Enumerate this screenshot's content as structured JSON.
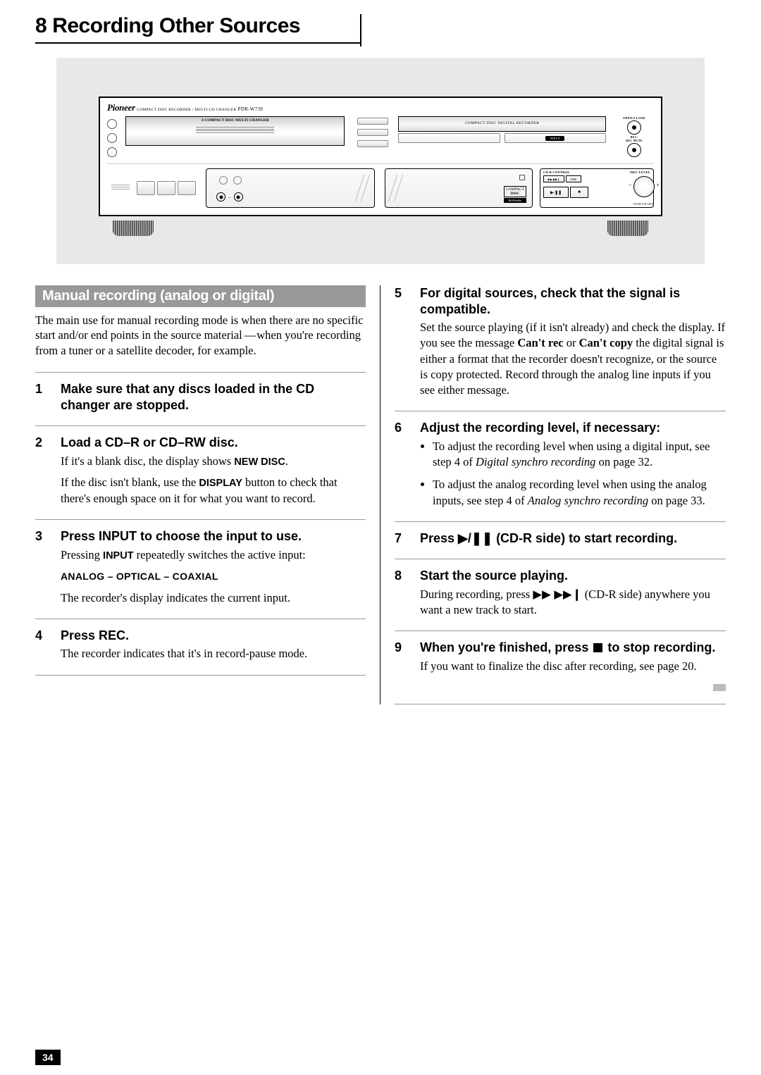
{
  "chapter": {
    "number": "8",
    "title": "Recording Other Sources"
  },
  "device": {
    "brand": "Pioneer",
    "brand_sub": "COMPACT DISC RECORDER / MULTI-CD CHANGER",
    "model": "PDR-W739",
    "changer_label": "3-COMPACT DISC MULTI CHANGER",
    "recorder_label": "COMPACT DISC DIGITAL RECORDER",
    "input_chip": "INPUT",
    "open_close": "OPEN/CLOSE",
    "rec_mute": "REC/\nREC MUTE",
    "cdr_control": "CD-R CONTROL",
    "rec_level": "○REC LEVEL",
    "disp": "DISP",
    "play_pause": "▶/❚❚",
    "stop": "■",
    "ff": "▶▶ ▶▶❙",
    "push": "PUSH ON-OFF",
    "cd_logo": "COMPACT",
    "disc_logo": "DISC",
    "rewritable": "ReWritable"
  },
  "subsection": "Manual recording (analog or digital)",
  "intro_prefix": "The main use for manual recording mode is when there are no specific start and/or end points in the source material",
  "intro_suffix": "when you're recording from a tuner or a satellite decoder, for example.",
  "steps_left": [
    {
      "n": "1",
      "title": "Make sure that any discs loaded in the CD changer are stopped."
    },
    {
      "n": "2",
      "title": "Load a CD–R or CD–RW disc.",
      "body": [
        "If it's a blank disc, the display shows <span class='scaps'>NEW DISC</span>.",
        "If the disc isn't blank, use the <span class='scaps'>DISPLAY</span> button to check that there's enough space on it for what you want to record."
      ]
    },
    {
      "n": "3",
      "title": "Press INPUT to choose the input to use.",
      "body": [
        "Pressing <span class='scaps'>INPUT</span> repeatedly switches the active input:",
        "<span class='caps'>ANALOG – OPTICAL – COAXIAL</span>",
        "The recorder's display indicates the current input."
      ]
    },
    {
      "n": "4",
      "title": "Press REC.",
      "body": [
        "The recorder indicates that it's in record-pause mode."
      ]
    }
  ],
  "steps_right": [
    {
      "n": "5",
      "title": "For digital sources, check that the signal is compatible.",
      "body": [
        "Set the source playing (if it isn't already) and check the display. If you see the message <b>Can't rec</b> or <b>Can't copy</b> the digital signal is either a format that the recorder doesn't recognize, or the source is copy protected. Record through the analog line inputs if you see either message."
      ]
    },
    {
      "n": "6",
      "title": "Adjust the recording level, if necessary:",
      "bullets": [
        "To adjust the recording level when using a digital input, see step 4 of <span class='ital'>Digital synchro recording</span> on page 32.",
        "To adjust the analog recording level when using the analog inputs, see step 4 of <span class='ital'>Analog synchro recording</span> on page 33."
      ]
    },
    {
      "n": "7",
      "title_html": "Press <span class='sym'>▶/❚❚</span> (CD-R side) to start recording."
    },
    {
      "n": "8",
      "title": "Start the source playing.",
      "body": [
        "During recording, press <span class='sym'>▶▶ ▶▶❙</span> (CD-R side) anywhere you want a new track to start."
      ]
    },
    {
      "n": "9",
      "title_html": "When you're finished, press <span class='stop-sq'></span> to stop recording.",
      "body": [
        "If you want to finalize the disc after recording, see page 20."
      ],
      "end": true
    }
  ],
  "page_number": "34"
}
